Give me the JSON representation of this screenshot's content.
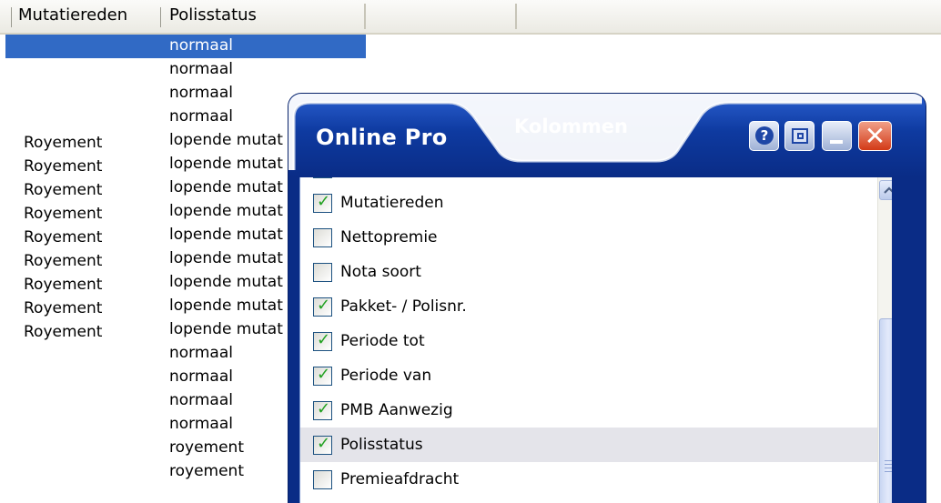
{
  "grid": {
    "columns": [
      "Mutatiereden",
      "Polisstatus"
    ],
    "rows": [
      {
        "mutatiereden": "",
        "polisstatus": "normaal"
      },
      {
        "mutatiereden": "",
        "polisstatus": "normaal"
      },
      {
        "mutatiereden": "",
        "polisstatus": "normaal"
      },
      {
        "mutatiereden": "",
        "polisstatus": "normaal"
      },
      {
        "mutatiereden": "Royement",
        "polisstatus": "lopende mutat"
      },
      {
        "mutatiereden": "Royement",
        "polisstatus": "lopende mutat"
      },
      {
        "mutatiereden": "Royement",
        "polisstatus": "lopende mutat"
      },
      {
        "mutatiereden": "Royement",
        "polisstatus": "lopende mutat"
      },
      {
        "mutatiereden": "Royement",
        "polisstatus": "lopende mutat"
      },
      {
        "mutatiereden": "Royement",
        "polisstatus": "lopende mutat"
      },
      {
        "mutatiereden": "Royement",
        "polisstatus": "lopende mutat"
      },
      {
        "mutatiereden": "Royement",
        "polisstatus": "lopende mutat"
      },
      {
        "mutatiereden": "Royement",
        "polisstatus": "lopende mutat"
      },
      {
        "mutatiereden": "",
        "polisstatus": "normaal"
      },
      {
        "mutatiereden": "",
        "polisstatus": "normaal"
      },
      {
        "mutatiereden": "",
        "polisstatus": "normaal"
      },
      {
        "mutatiereden": "",
        "polisstatus": "normaal"
      },
      {
        "mutatiereden": "",
        "polisstatus": "royement"
      },
      {
        "mutatiereden": "",
        "polisstatus": "royement"
      }
    ]
  },
  "dialog": {
    "app_title": "Online Pro",
    "tab_title": "Kolommen",
    "buttons": {
      "help": "?",
      "close": "✕"
    },
    "colors": {
      "title_bar": "#0a2c86",
      "close_button": "#d33a17",
      "check": "#21a121",
      "selection": "#316ac5"
    },
    "items": [
      {
        "label": "Mutatiereden",
        "checked": true
      },
      {
        "label": "Nettopremie",
        "checked": false
      },
      {
        "label": "Nota soort",
        "checked": false
      },
      {
        "label": "Pakket- / Polisnr.",
        "checked": true
      },
      {
        "label": "Periode tot",
        "checked": true
      },
      {
        "label": "Periode van",
        "checked": true
      },
      {
        "label": "PMB Aanwezig",
        "checked": true
      },
      {
        "label": "Polisstatus",
        "checked": true
      },
      {
        "label": "Premieafdracht",
        "checked": false
      }
    ]
  }
}
